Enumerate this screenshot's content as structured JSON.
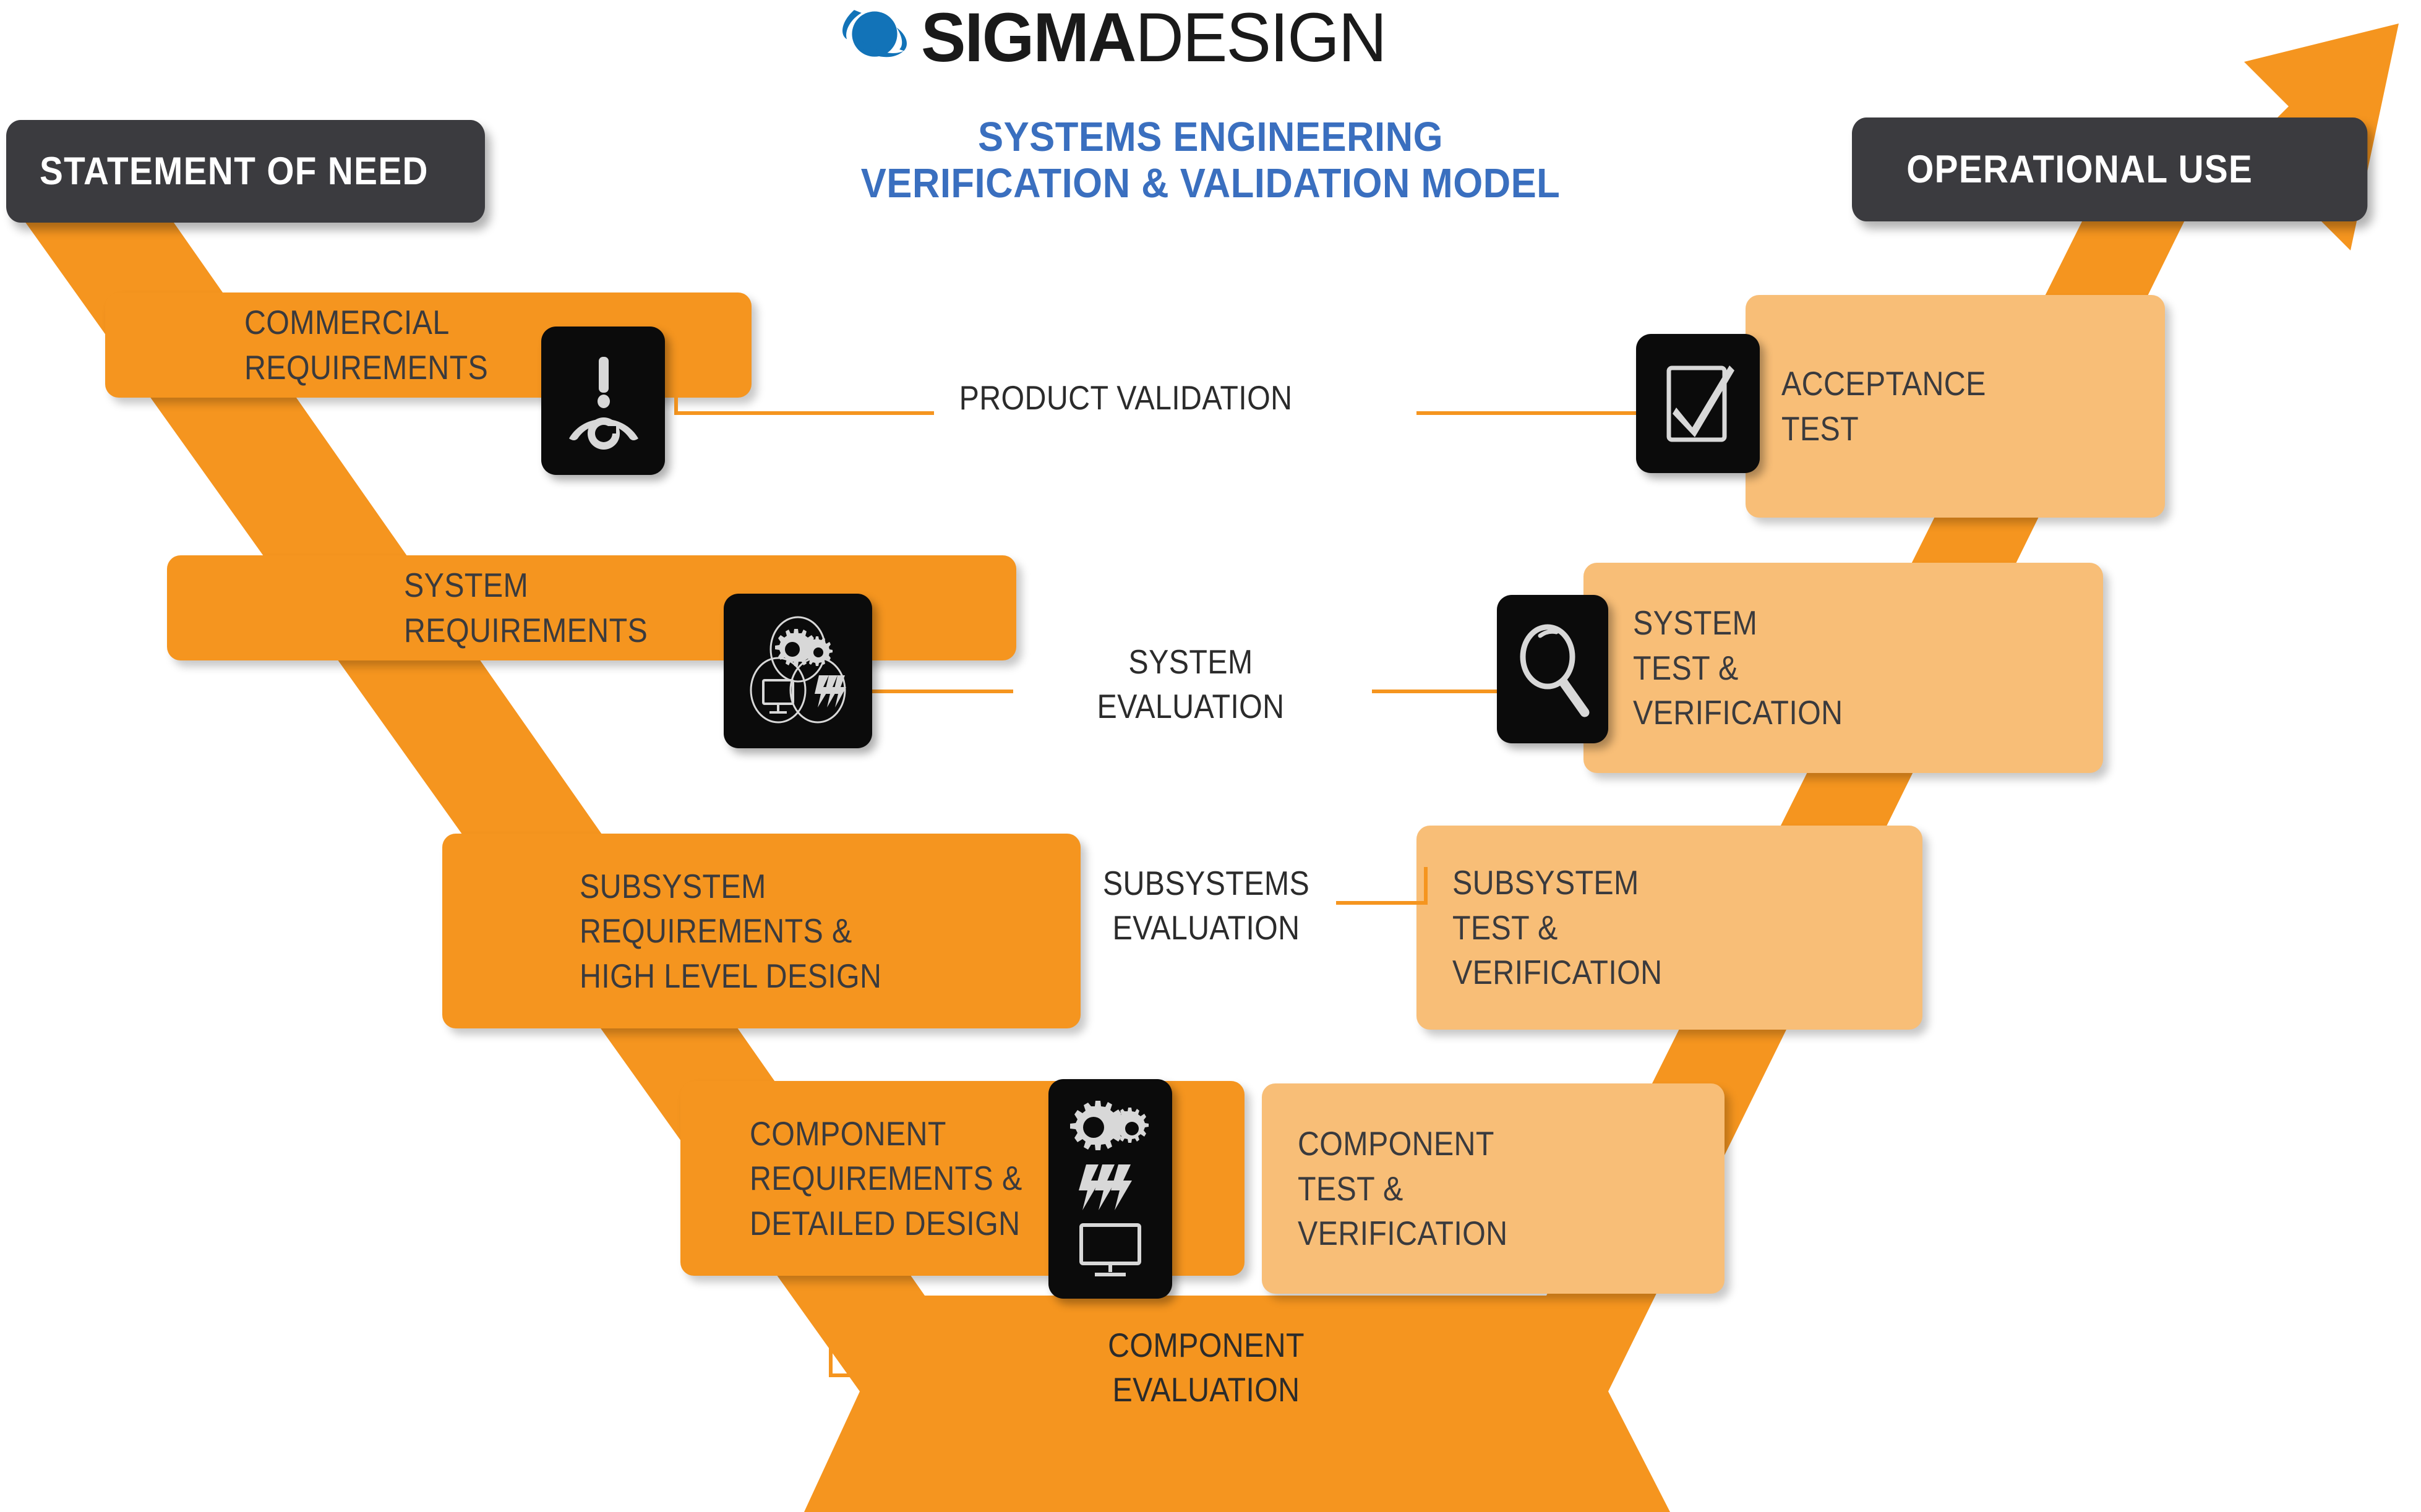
{
  "brand": {
    "logo_icon": "planet-orbit-icon",
    "name_bold": "SIGMA",
    "name_light": "DESIGN",
    "accent_blue": "#3a6fbf",
    "logo_blue": "#1273b8"
  },
  "title": {
    "line1": "SYSTEMS ENGINEERING",
    "line2": "VERIFICATION & VALIDATION MODEL"
  },
  "headers": {
    "start": "STATEMENT OF NEED",
    "end": "OPERATIONAL USE"
  },
  "colors": {
    "orange_dark": "#F5951F",
    "orange_light": "#F8BE77",
    "charcoal": "#3b3b3f",
    "icon_tile": "#0b0b0b",
    "text_dark": "#3a3a3d"
  },
  "left_stages": [
    {
      "id": "commercial",
      "label": "COMMERCIAL\nREQUIREMENTS",
      "icon": "alert-eye-icon"
    },
    {
      "id": "system",
      "label": "SYSTEM\nREQUIREMENTS",
      "icon": "gears-monitor-bolt-venn-icon"
    },
    {
      "id": "subsystem",
      "label": "SUBSYSTEM\nREQUIREMENTS &\nHIGH LEVEL DESIGN",
      "icon": null
    },
    {
      "id": "component",
      "label": "COMPONENT\nREQUIREMENTS &\nDETAILED DESIGN",
      "icon": "gears-bolt-monitor-stack-icon"
    }
  ],
  "right_stages": [
    {
      "id": "acceptance",
      "label": "ACCEPTANCE\nTEST",
      "icon": "checkbox-check-icon"
    },
    {
      "id": "system_test",
      "label": "SYSTEM\nTEST &\nVERIFICATION",
      "icon": "magnifier-icon"
    },
    {
      "id": "subsys_test",
      "label": "SUBSYSTEM\nTEST &\nVERIFICATION",
      "icon": null
    },
    {
      "id": "comp_test",
      "label": "COMPONENT\nTEST &\nVERIFICATION",
      "icon": null
    }
  ],
  "connectors": [
    {
      "id": "product",
      "label": "PRODUCT VALIDATION"
    },
    {
      "id": "system",
      "label": "SYSTEM\nEVALUATION"
    },
    {
      "id": "subsystems",
      "label": "SUBSYSTEMS\nEVALUATION"
    },
    {
      "id": "component",
      "label": "COMPONENT\nEVALUATION"
    }
  ]
}
